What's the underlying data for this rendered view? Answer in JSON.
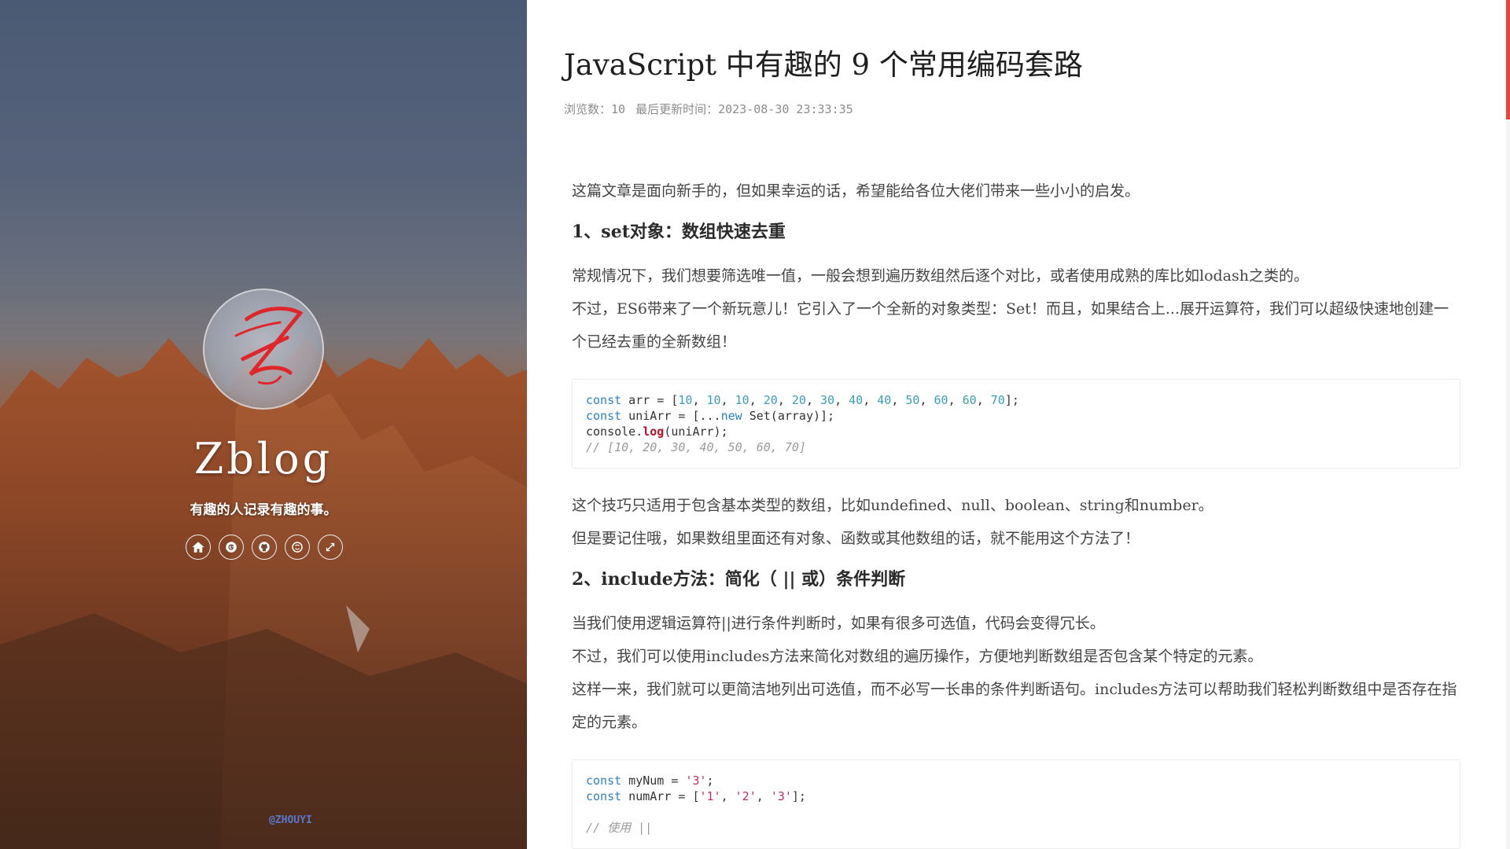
{
  "sidebar": {
    "site_title": "Zblog",
    "tagline": "有趣的人记录有趣的事。",
    "avatar_letter": "Z",
    "social": [
      {
        "icon": "home-icon"
      },
      {
        "icon": "g-icon"
      },
      {
        "icon": "github-icon"
      },
      {
        "icon": "skype-icon"
      },
      {
        "icon": "expand-icon"
      }
    ],
    "credit": "@ZHOUYI"
  },
  "post": {
    "title": "JavaScript 中有趣的 9 个常用编码套路",
    "meta_views": "浏览数：10",
    "meta_updated": "最后更新时间：2023-08-30 23:33:35",
    "intro": "这篇文章是面向新手的，但如果幸运的话，希望能给各位大佬们带来一些小小的启发。",
    "section1": {
      "heading": "1、set对象：数组快速去重",
      "p1": "常规情况下，我们想要筛选唯一值，一般会想到遍历数组然后逐个对比，或者使用成熟的库比如lodash之类的。",
      "p2": "不过，ES6带来了一个新玩意儿！它引入了一个全新的对象类型：Set！而且，如果结合上...展开运算符，我们可以超级快速地创建一个已经去重的全新数组！",
      "code": {
        "l1_kw": "const",
        "l1_var": " arr = [",
        "l1_nums": [
          "10",
          "10",
          "10",
          "20",
          "20",
          "30",
          "40",
          "40",
          "50",
          "60",
          "60",
          "70"
        ],
        "l1_end": "];",
        "l2_kw": "const",
        "l2_a": " uniArr = [...",
        "l2_new": "new",
        "l2_b": " Set(array)];",
        "l3_a": "console.",
        "l3_fn": "log",
        "l3_b": "(uniArr);",
        "l4_comment": "// [10, 20, 30, 40, 50, 60, 70]"
      },
      "p3": "这个技巧只适用于包含基本类型的数组，比如undefined、null、boolean、string和number。",
      "p4": "但是要记住哦，如果数组里面还有对象、函数或其他数组的话，就不能用这个方法了！"
    },
    "section2": {
      "heading": "2、include方法：简化（ || 或）条件判断",
      "p1": "当我们使用逻辑运算符||进行条件判断时，如果有很多可选值，代码会变得冗长。",
      "p2": "不过，我们可以使用includes方法来简化对数组的遍历操作，方便地判断数组是否包含某个特定的元素。",
      "p3": "这样一来，我们就可以更简洁地列出可选值，而不必写一长串的条件判断语句。includes方法可以帮助我们轻松判断数组中是否存在指定的元素。",
      "code": {
        "l1_kw": "const",
        "l1_a": " myNum = ",
        "l1_str": "'3'",
        "l1_b": ";",
        "l2_kw": "const",
        "l2_a": " numArr = [",
        "l2_s1": "'1'",
        "l2_s2": "'2'",
        "l2_s3": "'3'",
        "l2_b": "];",
        "l3_comment": "// 使用 ||"
      }
    }
  },
  "colors": {
    "accent": "#e8443a",
    "keyword": "#2f81c5",
    "number": "#3c9db0",
    "string": "#c22d6b",
    "function": "#b3122b"
  }
}
